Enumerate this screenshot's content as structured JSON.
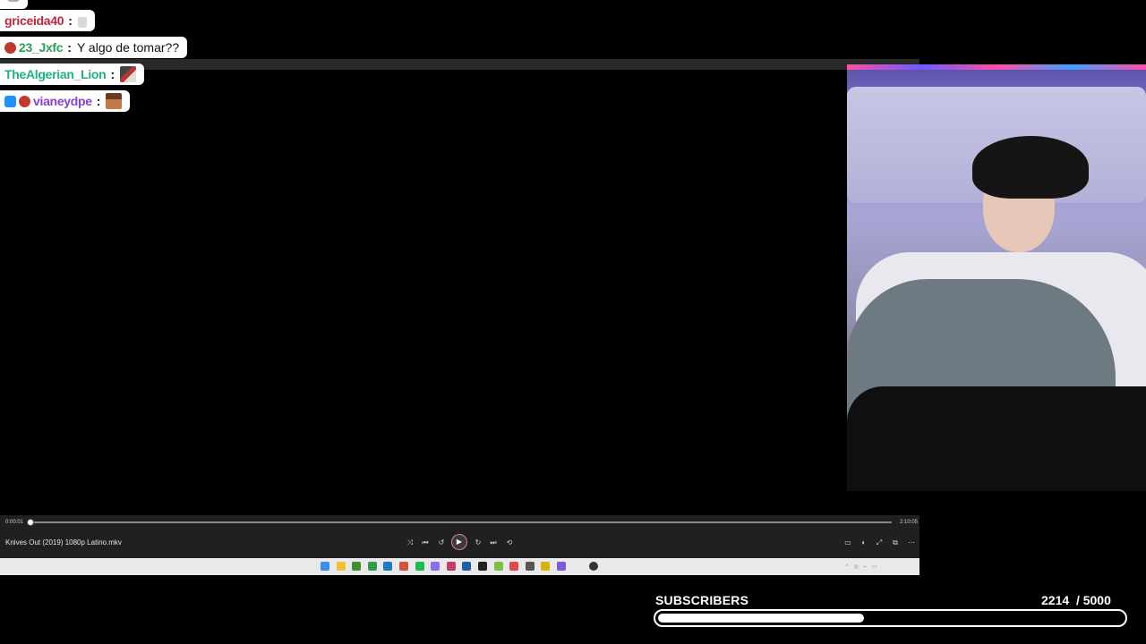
{
  "chat": {
    "messages": [
      {
        "username": "",
        "text": "",
        "username_color": "#b03a3a",
        "badges": [],
        "emote": "partial-emote"
      },
      {
        "username": "griceida40",
        "text": "",
        "username_color": "#c0243f",
        "badges": [],
        "emote": "glass-emote"
      },
      {
        "username": "23_Jxfc",
        "text": "Y algo de tomar??",
        "username_color": "#2aa05a",
        "badges": [
          "bear-badge"
        ],
        "emote": ""
      },
      {
        "username": "TheAlgerian_Lion",
        "text": "",
        "username_color": "#1fb37a",
        "badges": [],
        "emote": "pixel-emote"
      },
      {
        "username": "vianeydpe",
        "text": "",
        "username_color": "#8a3fd0",
        "badges": [
          "cube-badge",
          "bear-badge"
        ],
        "emote": "face-emote"
      }
    ],
    "separator": ":"
  },
  "player": {
    "elapsed": "0:00:01",
    "total": "2:10:05",
    "progress": 0.0,
    "file_name": "Knives Out (2019) 1080p Latino.mkv",
    "controls": {
      "shuffle": "shuffle-icon",
      "previous": "previous-icon",
      "rewind": "rewind-icon",
      "play": "play-icon",
      "forward": "forward-icon",
      "next": "next-icon",
      "repeat": "repeat-icon",
      "subtitles": "subtitles-icon",
      "volume": "volume-icon",
      "fullscreen": "fullscreen-icon",
      "miniplayer": "miniplayer-icon",
      "more": "more-icon"
    },
    "accent_color": "#e07ab6"
  },
  "taskbar": {
    "apps": [
      {
        "name": "start-icon",
        "color": "#3a8ee6"
      },
      {
        "name": "explorer-icon",
        "color": "#f2c12e"
      },
      {
        "name": "nvidia-icon",
        "color": "#3f8f2a"
      },
      {
        "name": "chrome-icon",
        "color": "#2f9e4f"
      },
      {
        "name": "edge-icon",
        "color": "#1b7fbf"
      },
      {
        "name": "browser-icon",
        "color": "#d2543a"
      },
      {
        "name": "spotify-icon",
        "color": "#1db954"
      },
      {
        "name": "discord-icon",
        "color": "#8a6cf0"
      },
      {
        "name": "app-icon",
        "color": "#c23b6a"
      },
      {
        "name": "app-icon-2",
        "color": "#1f5fa8"
      },
      {
        "name": "app-icon-3",
        "color": "#222"
      },
      {
        "name": "app-icon-4",
        "color": "#7ac143"
      },
      {
        "name": "app-icon-5",
        "color": "#e04a4a"
      },
      {
        "name": "app-icon-6",
        "color": "#555"
      },
      {
        "name": "app-icon-7",
        "color": "#d9b300"
      },
      {
        "name": "app-icon-8",
        "color": "#7b5cd6"
      },
      {
        "name": "media-player-icon",
        "color": "#333"
      }
    ],
    "tray": "^ ◎ ⌁ ▭",
    "clock_time": "",
    "clock_date": ""
  },
  "goal": {
    "label": "SUBSCRIBERS",
    "current": "2214",
    "target": "/ 5000",
    "fraction": 0.4428
  }
}
